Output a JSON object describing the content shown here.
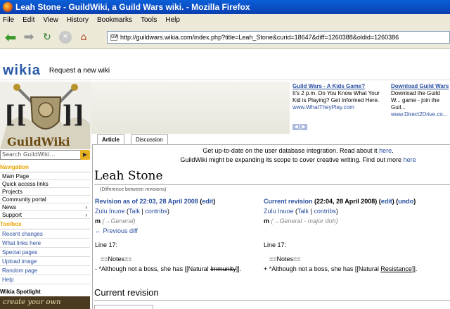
{
  "window": {
    "title": "Leah Stone - GuildWiki, a Guild Wars wiki. - Mozilla Firefox"
  },
  "menu": [
    "File",
    "Edit",
    "View",
    "History",
    "Bookmarks",
    "Tools",
    "Help"
  ],
  "address": {
    "url": "http://guildwars.wikia.com/index.php?title=Leah_Stone&curid=18647&diff=1260388&oldid=1260386",
    "favicon": "GW"
  },
  "wikia": {
    "logo": "wikia",
    "request": "Request a new wiki"
  },
  "logo": {
    "text": "GuildWiki"
  },
  "search": {
    "placeholder": "Search GuildWiki..."
  },
  "navigation": {
    "heading": "Navigation",
    "items": [
      "Main Page",
      "Quick access links",
      "Projects",
      "Community portal",
      "News",
      "Support"
    ]
  },
  "toolbox": {
    "heading": "Toolbox",
    "items": [
      "Recent changes",
      "What links here",
      "Special pages",
      "Upload image",
      "Random page",
      "Help"
    ]
  },
  "spotlight": {
    "heading": "Wikia Spotlight",
    "banner": "create your own"
  },
  "ads": [
    {
      "headline": "Guild Wars - A Kids Game?",
      "body": "It's 2 p.m. Do You Know What Your Kid is Playing? Get Informed Here.",
      "url": "www.WhatTheyPlay.com"
    },
    {
      "headline": "Download Guild Wars",
      "body": "Download the Guild W... game - join the Guil...",
      "url": "www.Direct2Drive.co..."
    }
  ],
  "tabs": {
    "article": "Article",
    "discussion": "Discussion"
  },
  "sitenotice": {
    "line1": "Get up-to-date on the user database integration. Read about it",
    "line1_link": "here",
    "line2": "GuildWiki might be expanding its scope to cover creative writing. Find out more",
    "line2_link": "here"
  },
  "page": {
    "title": "Leah Stone",
    "subtitle": "(Difference between revisions)"
  },
  "left_rev": {
    "header": "Revision as of 22:03, 28 April 2008",
    "edit": "edit",
    "user": "Zulu Inuoe",
    "talk": "Talk",
    "contribs": "contribs",
    "minor": "m",
    "summary": "(→General)",
    "prev": "← Previous diff",
    "line": "Line 17:",
    "notes": "==Notes==",
    "diff_prefix": "- *Although not a boss, she has [[Natural ",
    "diff_changed": "Immunity",
    "diff_suffix": "]]."
  },
  "right_rev": {
    "header_label": "Current revision",
    "header_date": "(22:04, 28 April 2008)",
    "edit": "edit",
    "undo": "undo",
    "user": "Zulu Inuoe",
    "talk": "Talk",
    "contribs": "contribs",
    "minor": "m",
    "summary": "(→General - major doh)",
    "line": "Line 17:",
    "notes": "==Notes==",
    "diff_prefix": "+ *Although not a boss, she has [[Natural ",
    "diff_changed": "Resistance",
    "diff_suffix": "]]."
  },
  "section": {
    "heading": "Current revision"
  }
}
